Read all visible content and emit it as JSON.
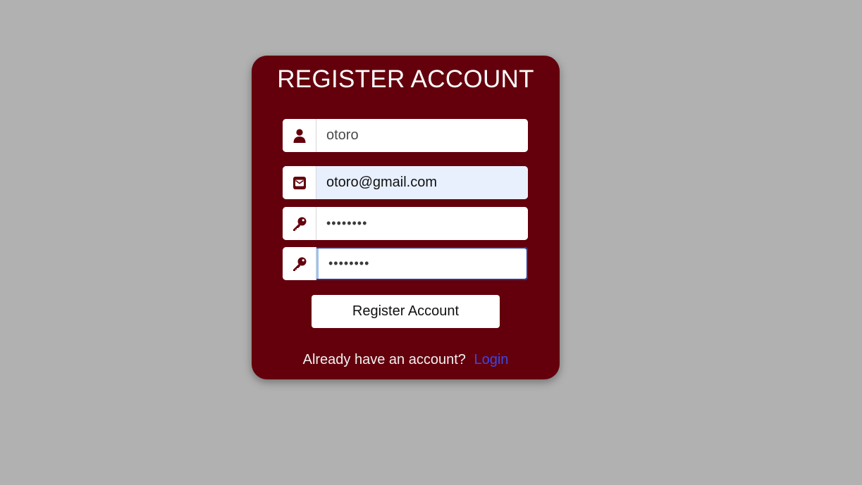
{
  "page": {
    "background_color": "#b1b1b1",
    "card_color": "#63000c",
    "accent_color": "#63000c",
    "link_color": "#3b48e6"
  },
  "form": {
    "title": "REGISTER ACCOUNT",
    "username": {
      "icon": "user-icon",
      "value": "otoro"
    },
    "email": {
      "icon": "envelope-icon",
      "value": "otoro@gmail.com"
    },
    "password": {
      "icon": "key-icon",
      "value": "12345678"
    },
    "confirm_password": {
      "icon": "key-icon",
      "value": "12345678"
    },
    "submit_label": "Register Account",
    "footer_text": "Already have an account?",
    "login_link": "Login"
  }
}
